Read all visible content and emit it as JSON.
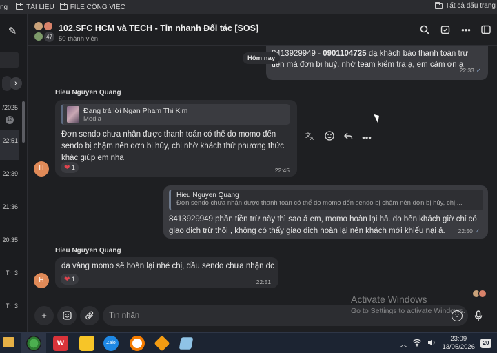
{
  "bookmarks": {
    "items": [
      "ng",
      "TÀI LIỆU",
      "FILE CÔNG VIỆC"
    ],
    "all_label": "Tất cả dấu trang"
  },
  "sidebar": {
    "times": [
      "/2025",
      "22:51",
      "22:39",
      "21:36",
      "20:35",
      "Th 3",
      "Th 3"
    ],
    "dot_label": "12"
  },
  "header": {
    "title": "102.SFC HCM và TECH - Tin nhanh Đối tác [SOS]",
    "members": "50 thành viên",
    "avatar_count": "47"
  },
  "messages": {
    "date_chip": "Hôm nay",
    "top_out": {
      "prefix": "8413929949 - ",
      "phone": "0901104725",
      "rest": " dạ khách báo thanh toán trừ tiền mà đơn bị huỷ. nhờ team kiểm tra ạ, em cảm ơn ạ",
      "time": "22:33"
    },
    "msg1": {
      "sender": "Hieu Nguyen Quang",
      "avatar": "H",
      "reply_label": "Đang trả lời Ngan Pham Thi Kim",
      "reply_sub": "Media",
      "text": "Đơn sendo chưa nhận được thanh toán có thể do momo đến sendo bị chậm nên đơn bị hủy, chị nhờ khách thử phương thức khác giúp em nha",
      "reaction_count": "1",
      "time": "22:45"
    },
    "msg2": {
      "quote_name": "Hieu Nguyen Quang",
      "quote_text": "Đơn sendo chưa nhận được thanh toán có thể do momo đến sendo bị chậm nên đơn bị hủy, chị ...",
      "text": "8413929949  phần tiền trừ này thì sao á em, momo hoàn lại hả. do bên khách giờ chỉ có giao dịch trừ thôi , không có thấy giao dịch hoàn lại nên khách mới khiếu nại á.",
      "time": "22:50"
    },
    "msg3": {
      "sender": "Hieu Nguyen Quang",
      "avatar": "H",
      "text": "dạ vâng momo sẽ hoàn lại nhé chị, đầu sendo chưa nhận dc ạ",
      "reaction_count": "1",
      "time": "22:51"
    }
  },
  "composer": {
    "placeholder": "Tin nhắn"
  },
  "watermark": {
    "line1": "Activate Windows",
    "line2": "Go to Settings to activate Windows."
  },
  "taskbar": {
    "time": "23:09",
    "date": "13/05/2026",
    "notifications": "20"
  },
  "colors": {
    "accent_orange": "#e08a58",
    "bubble_out": "#3a3b40",
    "bubble_in": "#2c2d31",
    "heart": "#e0444e"
  }
}
